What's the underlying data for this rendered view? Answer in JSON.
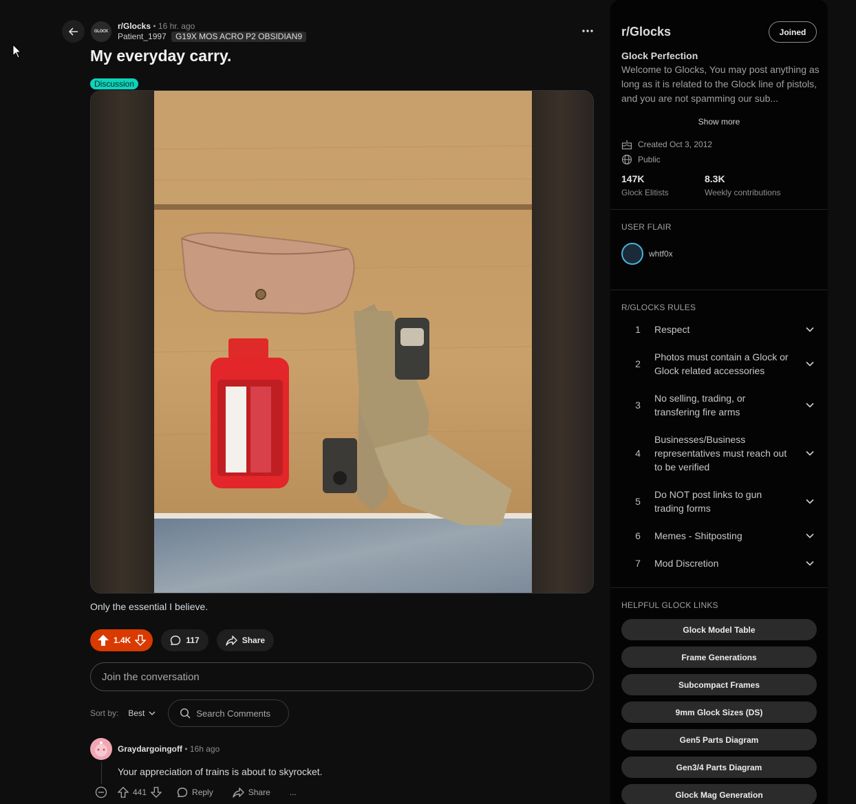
{
  "post": {
    "subreddit": "r/Glocks",
    "separator": "•",
    "time": "16 hr. ago",
    "author": "Patient_1997",
    "author_flair": "G19X MOS ACRO P2 OBSIDIAN9",
    "title": "My everyday carry.",
    "flair": "Discussion",
    "body": "Only the essential I believe.",
    "votes": "1.4K",
    "comments": "117",
    "share_label": "Share",
    "sub_avatar_text": "GLOCK"
  },
  "conversation": {
    "placeholder": "Join the conversation",
    "sort_label": "Sort by:",
    "sort_value": "Best",
    "search_placeholder": "Search Comments"
  },
  "comment": {
    "author": "Graydargoingoff",
    "separator": "•",
    "time": "16h ago",
    "text": "Your appreciation of trains is about to skyrocket.",
    "votes": "441",
    "reply_label": "Reply",
    "share_label": "Share",
    "more_label": "..."
  },
  "sidebar": {
    "name": "r/Glocks",
    "joined_label": "Joined",
    "title": "Glock Perfection",
    "description": "Welcome to Glocks, You may post anything as long as it is related to the Glock line of pistols, and you are not spamming our sub...",
    "show_more": "Show more",
    "created": "Created Oct 3, 2012",
    "visibility": "Public",
    "members_value": "147K",
    "members_label": "Glock Elitists",
    "weekly_value": "8.3K",
    "weekly_label": "Weekly contributions",
    "user_flair_heading": "USER FLAIR",
    "user_flair_name": "whtf0x",
    "rules_heading": "R/GLOCKS RULES",
    "rules": [
      {
        "num": "1",
        "text": "Respect"
      },
      {
        "num": "2",
        "text": "Photos must contain a Glock or Glock related accessories"
      },
      {
        "num": "3",
        "text": "No selling, trading, or transfering fire arms"
      },
      {
        "num": "4",
        "text": "Businesses/Business representatives must reach out to be verified"
      },
      {
        "num": "5",
        "text": "Do NOT post links to gun trading forms"
      },
      {
        "num": "6",
        "text": "Memes - Shitposting"
      },
      {
        "num": "7",
        "text": "Mod Discretion"
      }
    ],
    "links_heading": "HELPFUL GLOCK LINKS",
    "links": [
      "Glock Model Table",
      "Frame Generations",
      "Subcompact Frames",
      "9mm Glock Sizes (DS)",
      "Gen5 Parts Diagram",
      "Gen3/4 Parts Diagram",
      "Glock Mag Generation"
    ]
  },
  "colors": {
    "upvote_active": "#d93a00",
    "flair_discussion": "#0dd3bb",
    "background": "#0e0e0e",
    "sidebar": "#040404"
  },
  "icons": [
    "back-arrow-icon",
    "more-options-icon",
    "upvote-icon",
    "downvote-icon",
    "comment-icon",
    "share-icon",
    "search-icon",
    "chevron-down-icon",
    "cake-icon",
    "globe-icon",
    "collapse-icon",
    "cursor-icon"
  ]
}
